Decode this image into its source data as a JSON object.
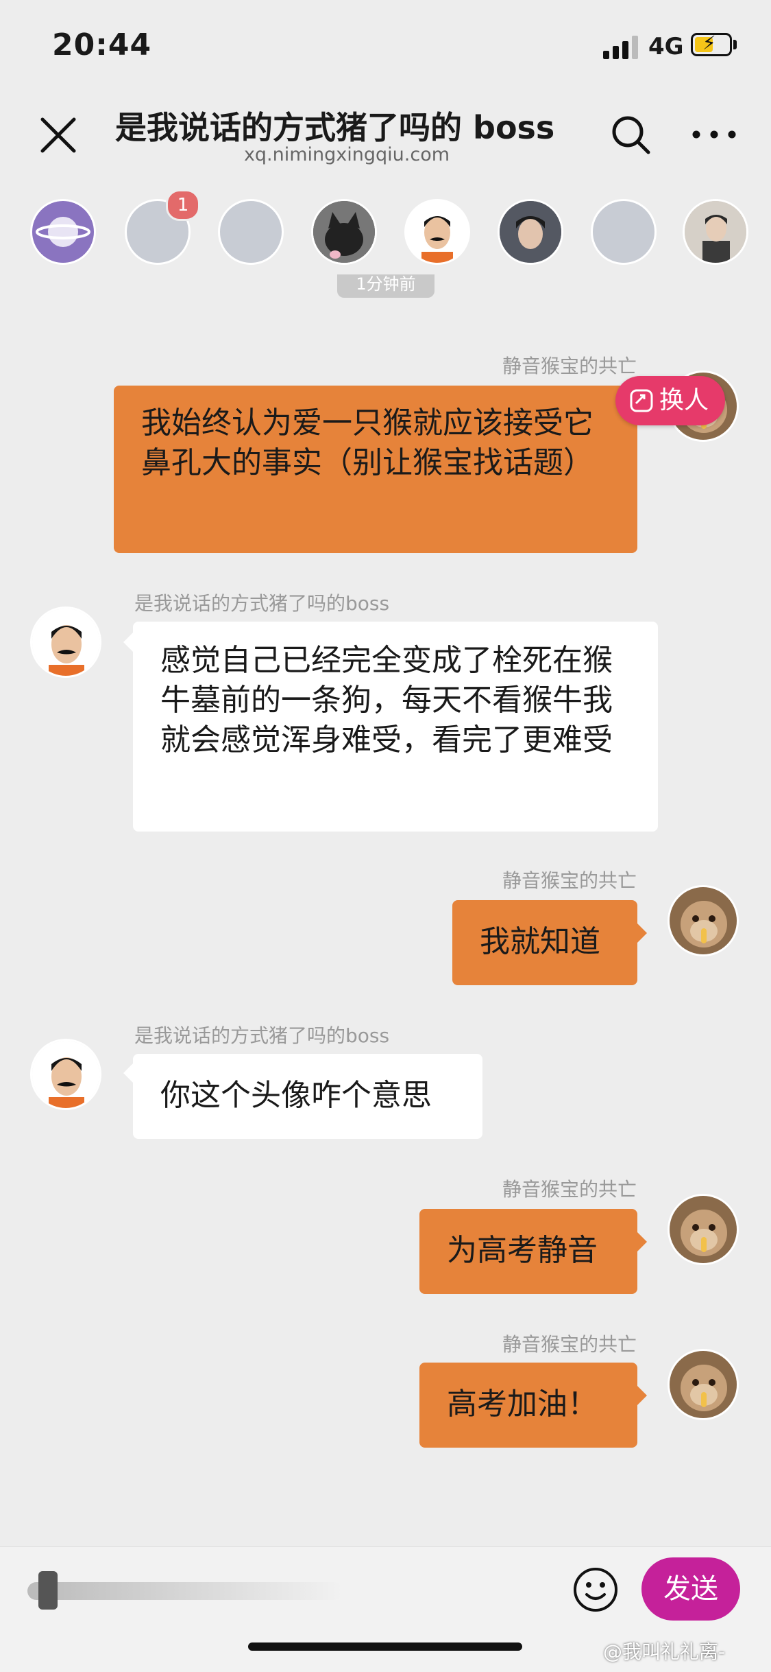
{
  "status": {
    "time": "20:44",
    "network": "4G"
  },
  "header": {
    "title": "是我说话的方式猪了吗的 boss",
    "subtitle": "xq.nimingxingqiu.com",
    "close_icon": "close-icon",
    "search_icon": "search-icon",
    "more_icon": "more-icon"
  },
  "avatar_strip": {
    "badge_count": "1"
  },
  "timestamp": "1分钟前",
  "swap_button": {
    "label": "换人",
    "icon": "swap-icon"
  },
  "messages": [
    {
      "side": "right",
      "sender": "静音猴宝的共亡",
      "text": "我始终认为爱一只猴就应该接受它鼻孔大的事实（别让猴宝找话题）"
    },
    {
      "side": "left",
      "sender": "是我说话的方式猪了吗的boss",
      "text": "感觉自己已经完全变成了栓死在猴牛墓前的一条狗，每天不看猴牛我就会感觉浑身难受，看完了更难受"
    },
    {
      "side": "right",
      "sender": "静音猴宝的共亡",
      "text": "我就知道"
    },
    {
      "side": "left",
      "sender": "是我说话的方式猪了吗的boss",
      "text": "你这个头像咋个意思"
    },
    {
      "side": "right",
      "sender": "静音猴宝的共亡",
      "text": "为高考静音"
    },
    {
      "side": "right",
      "sender": "静音猴宝的共亡",
      "text": "高考加油！"
    }
  ],
  "composer": {
    "emoji_icon": "emoji-icon",
    "send_label": "发送"
  },
  "watermark": "@我叫礼礼离-",
  "colors": {
    "outgoing_bubble": "#e6833a",
    "send_button": "#c5219a",
    "swap_button": "#e63a6a"
  }
}
